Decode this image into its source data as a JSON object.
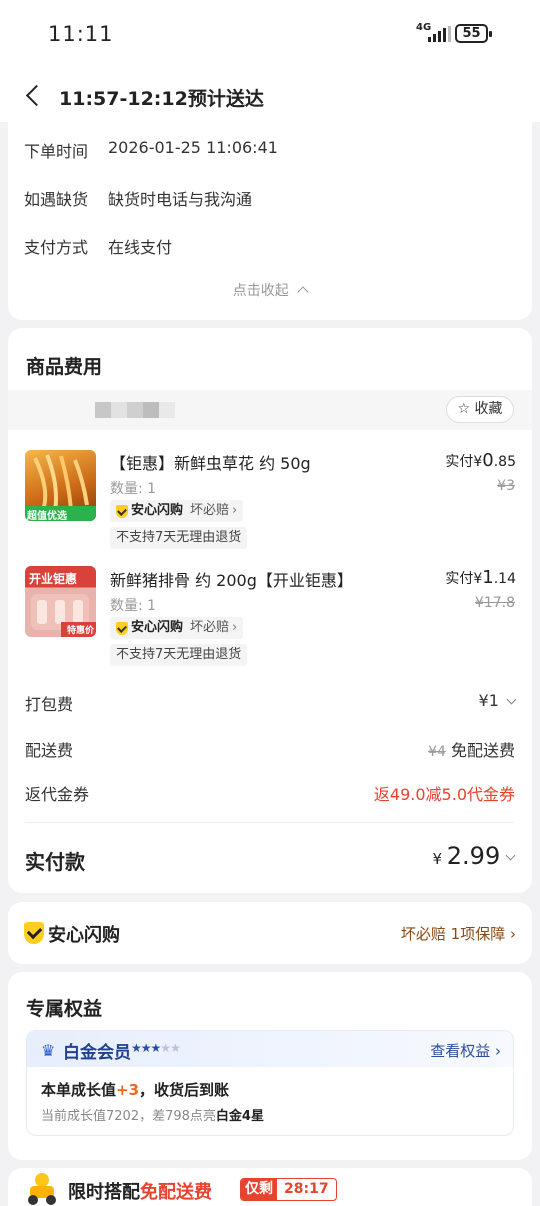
{
  "status": {
    "time": "11:11",
    "network": "4G",
    "battery": "55"
  },
  "header": {
    "title": "11:57-12:12预计送达"
  },
  "order_info": {
    "rows": [
      {
        "label": "下单时间",
        "value": "2026-01-25 11:06:41"
      },
      {
        "label": "如遇缺货",
        "value": "缺货时电话与我沟通"
      },
      {
        "label": "支付方式",
        "value": "在线支付"
      }
    ],
    "collapse_label": "点击收起"
  },
  "goods": {
    "title": "商品费用",
    "fav_label": "收藏",
    "items": [
      {
        "name": "【钜惠】新鲜虫草花 约 50g",
        "qty": "数量: 1",
        "img_label": "超值优选",
        "safe_tag": "安心闪购",
        "safe_tag_extra": "坏必赔",
        "no_return": "不支持7天无理由退货",
        "paid_prefix": "实付",
        "paid_currency": "¥",
        "paid_int": "0",
        "paid_dec": ".85",
        "orig_price": "¥3",
        "img_color": "#d8741c"
      },
      {
        "name": "新鲜猪排骨 约 200g【开业钜惠】",
        "qty": "数量: 1",
        "img_label": "开业钜惠",
        "img_label2": "特惠价",
        "safe_tag": "安心闪购",
        "safe_tag_extra": "坏必赔",
        "no_return": "不支持7天无理由退货",
        "paid_prefix": "实付",
        "paid_currency": "¥",
        "paid_int": "1",
        "paid_dec": ".14",
        "orig_price": "¥17.8",
        "img_color": "#c33a2e"
      }
    ],
    "fees": {
      "packing": {
        "label": "打包费",
        "value": "¥1"
      },
      "delivery": {
        "label": "配送费",
        "orig": "¥4",
        "value": "免配送费"
      },
      "coupon": {
        "label": "返代金券",
        "value": "返49.0减5.0代金券"
      }
    },
    "total": {
      "label": "实付款",
      "currency": "¥",
      "value": "2.99"
    }
  },
  "guarantee": {
    "title": "安心闪购",
    "link": "坏必赔 1项保障"
  },
  "benefits": {
    "title": "专属权益",
    "member_title": "白金会员",
    "stars_filled": 3,
    "stars_total": 5,
    "link": "查看权益",
    "line1_a": "本单成长值",
    "line1_plus": "+3",
    "line1_b": "，收货后到账",
    "line2_a": "当前成长值7202，差798点亮",
    "line2_b": "白金4星"
  },
  "promo": {
    "title_a": "限时搭配",
    "title_b": "免配送费",
    "timer_label": "仅剩",
    "timer_value": "28:17"
  },
  "colors": {
    "accent_red": "#e8432e",
    "gold": "#ffce1f",
    "member_blue": "#1f3f8f"
  }
}
